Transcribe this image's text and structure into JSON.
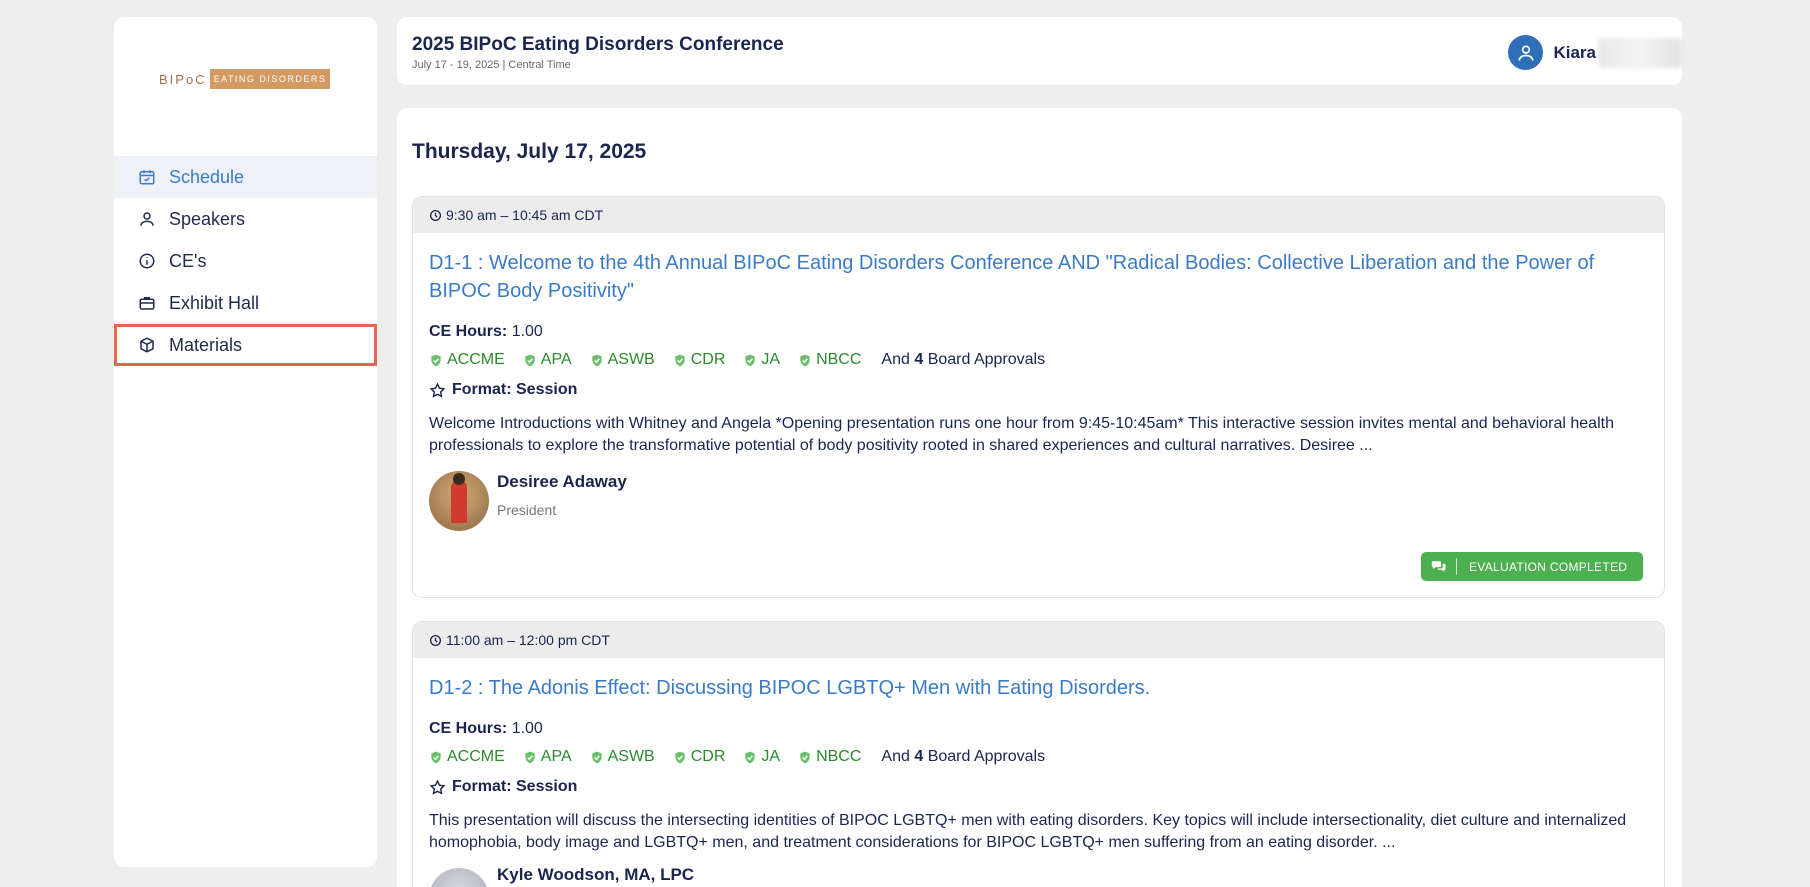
{
  "sidebar": {
    "logo": {
      "part1": "BIPoC",
      "part2": "EATING DISORDERS"
    },
    "items": [
      {
        "label": "Schedule",
        "icon": "calendar-check-icon",
        "active": true
      },
      {
        "label": "Speakers",
        "icon": "person-icon"
      },
      {
        "label": "CE's",
        "icon": "info-icon"
      },
      {
        "label": "Exhibit Hall",
        "icon": "briefcase-icon"
      },
      {
        "label": "Materials",
        "icon": "box-icon",
        "highlighted": true
      }
    ]
  },
  "header": {
    "title": "2025 BIPoC Eating Disorders Conference",
    "subtitle": "July 17 - 19, 2025 | Central Time",
    "user_name": "Kiara"
  },
  "main": {
    "day_heading": "Thursday, July 17, 2025",
    "sessions": [
      {
        "time": "9:30 am – 10:45 am CDT",
        "title": "D1-1 : Welcome to the 4th Annual BIPoC Eating Disorders Conference AND \"Radical Bodies: Collective Liberation and the Power of BIPOC Body Positivity\"",
        "ce_label": "CE Hours:",
        "ce_value": "1.00",
        "boards": [
          "ACCME",
          "APA",
          "ASWB",
          "CDR",
          "JA",
          "NBCC"
        ],
        "more_prefix": "And",
        "more_count": "4",
        "more_suffix": "Board Approvals",
        "format_label": "Format: Session",
        "description": "Welcome Introductions with Whitney and Angela *Opening presentation runs one hour from 9:45-10:45am* This interactive session invites mental and behavioral health professionals to explore the transformative potential of body positivity rooted in shared experiences and cultural narratives. Desiree ...",
        "speaker_name": "Desiree Adaway",
        "speaker_role": "President",
        "evaluation": "EVALUATION COMPLETED"
      },
      {
        "time": "11:00 am – 12:00 pm CDT",
        "title": "D1-2 : The Adonis Effect: Discussing BIPOC LGBTQ+ Men with Eating Disorders.",
        "ce_label": "CE Hours:",
        "ce_value": "1.00",
        "boards": [
          "ACCME",
          "APA",
          "ASWB",
          "CDR",
          "JA",
          "NBCC"
        ],
        "more_prefix": "And",
        "more_count": "4",
        "more_suffix": "Board Approvals",
        "format_label": "Format: Session",
        "description": "This presentation will discuss the intersecting identities of BIPOC LGBTQ+ men with eating disorders. Key topics will include intersectionality, diet culture and internalized homophobia, body image and LGBTQ+ men, and treatment considerations for BIPOC LGBTQ+ men suffering from an eating disorder. ...",
        "speaker_name": "Kyle Woodson, MA, LPC"
      }
    ]
  },
  "colors": {
    "accent": "#3a7bc8",
    "board_green": "#2b8a2b",
    "eval_green": "#4caf50",
    "highlight": "#e86453"
  }
}
